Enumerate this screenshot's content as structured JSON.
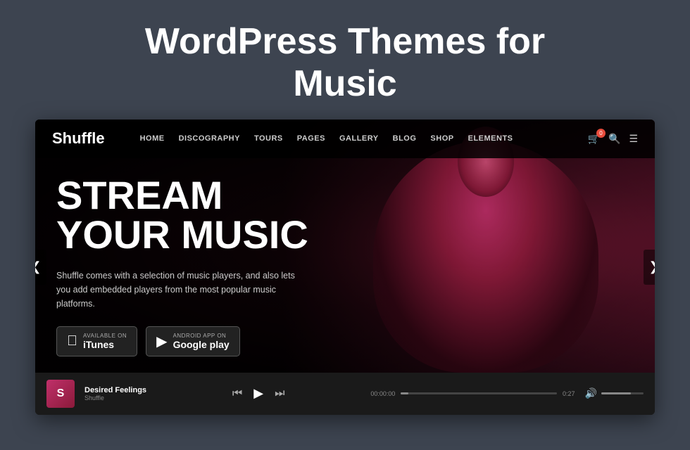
{
  "page": {
    "title_line1": "WordPress Themes for",
    "title_line2": "Music"
  },
  "nav": {
    "logo": "Shuffle",
    "links": [
      "HOME",
      "DISCOGRAPHY",
      "TOURS",
      "PAGES",
      "GALLERY",
      "BLOG",
      "SHOP",
      "ELEMENTS"
    ]
  },
  "hero": {
    "title_line1": "STREAM",
    "title_line2": "YOUR MUSIC",
    "subtitle": "Shuffle comes with a selection of music players, and also lets you add embedded players from the most popular music platforms.",
    "itunes_label_small": "Available on",
    "itunes_label": "iTunes",
    "google_label_small": "ANDROID APP ON",
    "google_label": "Google play"
  },
  "player": {
    "thumb_text": "S",
    "track_name": "Desired Feelings",
    "artist": "Shuffle",
    "time_current": "00:00:00",
    "time_total": "0:27",
    "progress_pct": 5,
    "volume_pct": 70
  },
  "carousel": {
    "left_arrow": "❮",
    "right_arrow": "❯"
  }
}
